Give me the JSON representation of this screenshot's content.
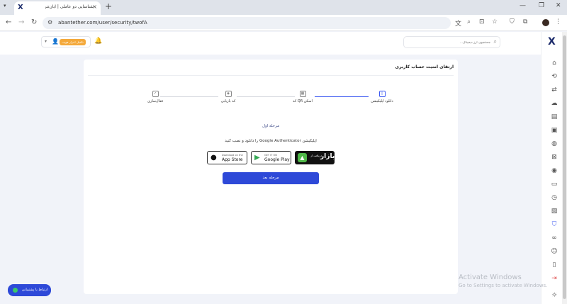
{
  "browser": {
    "tab_title": "شناسایی دو عاملی | آبان‌تتر",
    "favicon": "X",
    "url": "abantether.com/user/security/twofA",
    "new_tab_symbol": "+",
    "close_symbol": "×"
  },
  "header": {
    "search_placeholder": "جستجوی ارز دیجیتال...",
    "balance_badge": "تکمیل احراز هویت"
  },
  "card": {
    "title": "ارتقای امنیت حساب کاربری",
    "steps": [
      {
        "label": "دانلود اپلیکیشن",
        "state": "active"
      },
      {
        "label": "اسکن QR کد",
        "state": "pending"
      },
      {
        "label": "کد بازیابی",
        "state": "pending"
      },
      {
        "label": "فعال‌سازی",
        "state": "pending"
      }
    ],
    "stage_label": "مرحله اول",
    "instruction": "اپلیکیشن Google Authenticator را دانلود و نصب کنید",
    "stores": {
      "bazaar_small": "دریافت از",
      "bazaar_name": "بازار",
      "google_small": "GET IT ON",
      "google_name": "Google Play",
      "apple_small": "Download on the",
      "apple_name": "App Store"
    },
    "next_button": "مرحله بعد"
  },
  "chat": {
    "label": "ارتباط با پشتیبانی"
  },
  "watermark": {
    "title": "Activate Windows",
    "subtitle": "Go to Settings to activate Windows."
  },
  "colors": {
    "primary": "#2e49d8",
    "accent_orange": "#f4a93b",
    "bazaar_green": "#4fb848",
    "online_green": "#3ac96b"
  }
}
